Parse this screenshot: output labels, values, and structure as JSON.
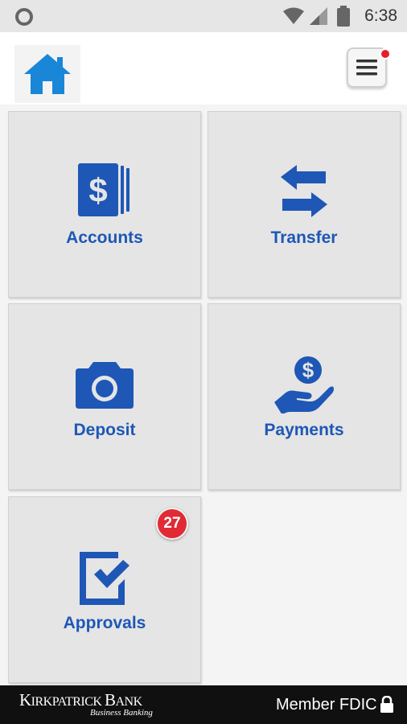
{
  "status_bar": {
    "time": "6:38"
  },
  "header": {
    "home_icon": "home-icon",
    "menu_icon": "hamburger-menu-icon",
    "has_notification": true
  },
  "tiles": {
    "accounts": {
      "label": "Accounts",
      "icon": "dollar-cards-icon"
    },
    "transfer": {
      "label": "Transfer",
      "icon": "transfer-arrows-icon"
    },
    "deposit": {
      "label": "Deposit",
      "icon": "camera-icon"
    },
    "payments": {
      "label": "Payments",
      "icon": "hand-coin-icon"
    },
    "approvals": {
      "label": "Approvals",
      "icon": "checkbox-icon",
      "badge": "27"
    }
  },
  "footer": {
    "bank_name_first": "K",
    "bank_name_rest": "IRKPATRICK ",
    "bank_name_second": "B",
    "bank_name_rest2": "ANK",
    "bank_subtitle": "Business Banking",
    "member_text": "Member FDIC"
  },
  "colors": {
    "accent": "#1e57b6",
    "home_icon": "#1a86d8",
    "badge": "#e02b35",
    "tile_bg": "#e5e5e5",
    "footer_bg": "#101010"
  }
}
